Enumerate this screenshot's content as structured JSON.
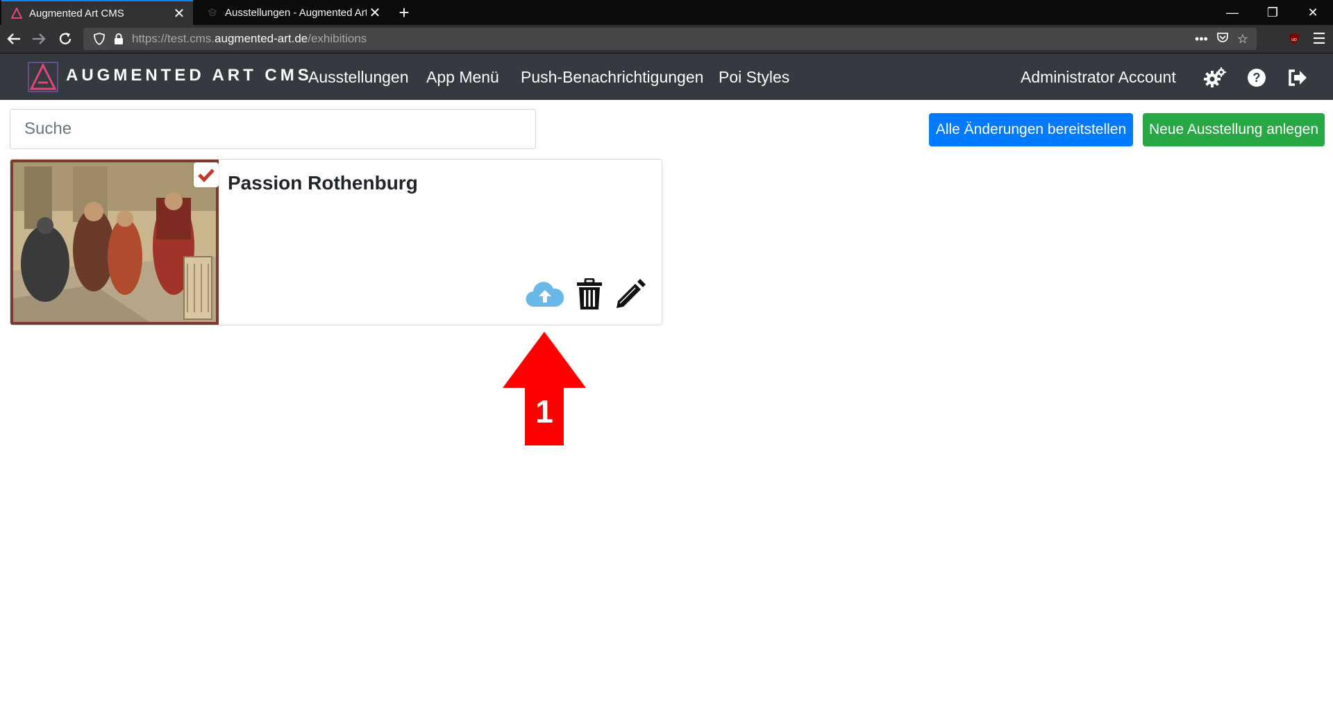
{
  "browser": {
    "tabs": [
      {
        "title": "Augmented Art CMS",
        "active": true
      },
      {
        "title": "Ausstellungen - Augmented Art",
        "active": false
      }
    ],
    "url_prefix": "https://test.cms.",
    "url_domain": "augmented-art.de",
    "url_path": "/exhibitions",
    "window_controls": {
      "minimize": "—",
      "restore": "❐",
      "close": "✕"
    }
  },
  "app": {
    "brand": "AUGMENTED ART CMS",
    "nav": {
      "exhibitions": "Ausstellungen",
      "app_menu": "App Menü",
      "push": "Push-Benachrichtigungen",
      "poi_styles": "Poi Styles",
      "account": "Administrator Account"
    },
    "colors": {
      "navbar": "#343a40",
      "primary": "#007bff",
      "success": "#28a745",
      "upload_icon": "#6ab8e8",
      "check_icon": "#c0392b",
      "annotation": "#ff0000"
    }
  },
  "toolbar": {
    "search_placeholder": "Suche",
    "deploy_all": "Alle Änderungen bereitstellen",
    "new_exhibition": "Neue Ausstellung anlegen"
  },
  "exhibitions": [
    {
      "title": "Passion Rothenburg",
      "selected": true
    }
  ],
  "annotation": {
    "number": "1"
  }
}
